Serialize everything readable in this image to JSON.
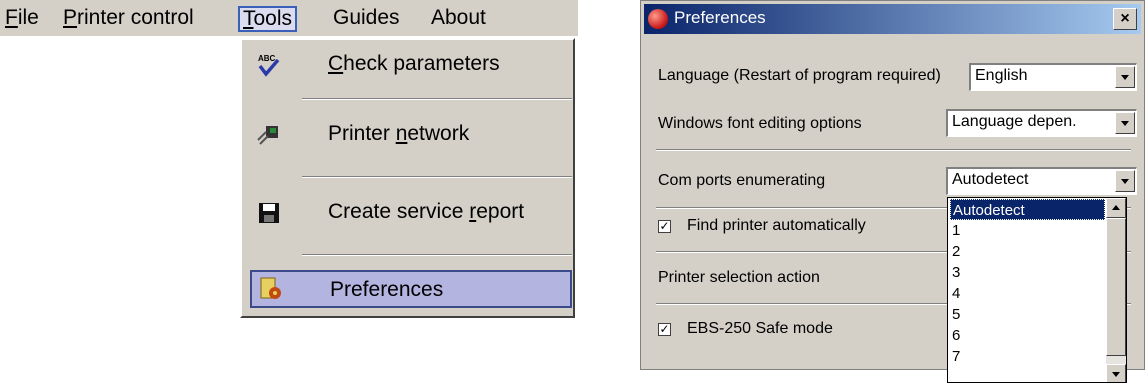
{
  "menubar": {
    "items": [
      {
        "label": "File",
        "mnemonic": "F",
        "rest": "ile"
      },
      {
        "label": "Printer control",
        "mnemonic": "P",
        "rest": "rinter control"
      },
      {
        "label": "Tools",
        "mnemonic": "T",
        "rest": "ools"
      },
      {
        "label": "Guides"
      },
      {
        "label": "About"
      }
    ]
  },
  "tools_menu": {
    "items": [
      {
        "pre": "",
        "mnemonic": "C",
        "post": "heck parameters",
        "icon": "spellcheck-icon"
      },
      {
        "pre": "Printer ",
        "mnemonic": "n",
        "post": "etwork",
        "icon": "network-icon"
      },
      {
        "pre": "Create service ",
        "mnemonic": "r",
        "post": "eport",
        "icon": "floppy-disk-icon"
      },
      {
        "pre": "Preferences",
        "mnemonic": "",
        "post": "",
        "icon": "preferences-icon"
      }
    ],
    "icon_text": "ABC"
  },
  "dialog": {
    "title": "Preferences",
    "close_glyph": "×",
    "language_label": "Language (Restart of program required)",
    "language_value": "English",
    "font_label": "Windows font editing options",
    "font_value": "Language depen.",
    "com_label": "Com ports enumerating",
    "com_value": "Autodetect",
    "find_printer_label": "Find printer automatically",
    "selection_label": "Printer selection action",
    "safe_mode_label": "EBS-250 Safe mode",
    "checkbox_glyph": "✓",
    "com_options": [
      "Autodetect",
      "1",
      "2",
      "3",
      "4",
      "5",
      "6",
      "7"
    ]
  },
  "colors": {
    "face": "#d4d0c8",
    "selection": "#0a246a",
    "menu_highlight": "#b4b4e0"
  }
}
